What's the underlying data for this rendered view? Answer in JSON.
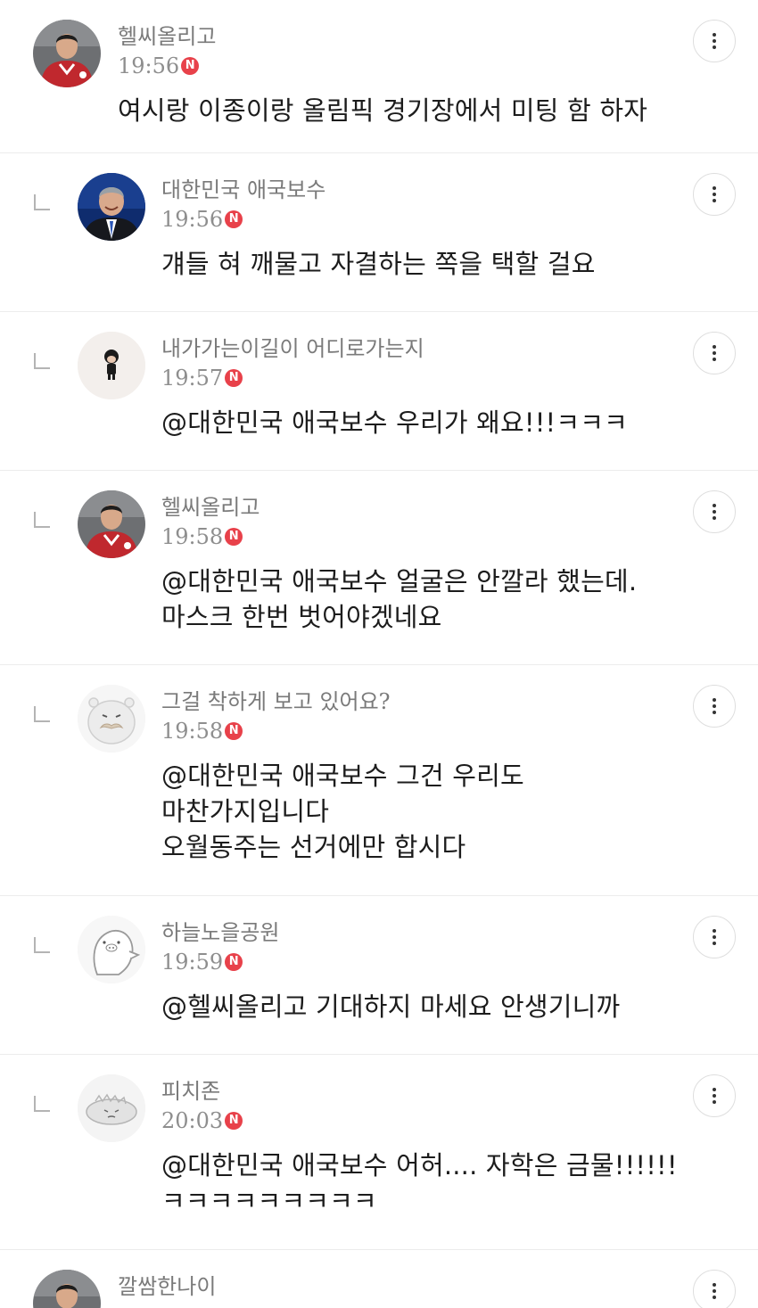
{
  "comments": [
    {
      "nickname": "헬씨올리고",
      "time": "19:56",
      "badge": "N",
      "lines": [
        "여시랑 이종이랑 올림픽 경기장에서 미팅 함 하자"
      ],
      "reply": false,
      "avatar_icon": "soccer-player-icon"
    },
    {
      "nickname": "대한민국 애국보수",
      "time": "19:56",
      "badge": "N",
      "lines": [
        "걔들 혀 깨물고 자결하는 쪽을 택할 걸요"
      ],
      "reply": true,
      "avatar_icon": "man-in-suit-icon"
    },
    {
      "nickname": "내가가는이길이 어디로가는지",
      "time": "19:57",
      "badge": "N",
      "lines": [
        "@대한민국 애국보수 우리가 왜요!!!ㅋㅋㅋ"
      ],
      "reply": true,
      "avatar_icon": "tiny-character-icon"
    },
    {
      "nickname": "헬씨올리고",
      "time": "19:58",
      "badge": "N",
      "lines": [
        "@대한민국 애국보수 얼굴은 안깔라 했는데.",
        "마스크 한번 벗어야겠네요"
      ],
      "reply": true,
      "avatar_icon": "soccer-player-icon"
    },
    {
      "nickname": "그걸 착하게 보고 있어요?",
      "time": "19:58",
      "badge": "N",
      "lines": [
        "@대한민국 애국보수 그건 우리도",
        "마찬가지입니다",
        "오월동주는 선거에만 합시다"
      ],
      "reply": true,
      "avatar_icon": "mustache-character-icon"
    },
    {
      "nickname": "하늘노을공원",
      "time": "19:59",
      "badge": "N",
      "lines": [
        "@헬씨올리고 기대하지 마세요 안생기니까"
      ],
      "reply": true,
      "avatar_icon": "pig-ghost-icon"
    },
    {
      "nickname": "피치존",
      "time": "20:03",
      "badge": "N",
      "lines": [
        "@대한민국 애국보수 어허.... 자학은 금물!!!!!!",
        "ㅋㅋㅋㅋㅋㅋㅋㅋㅋ"
      ],
      "reply": true,
      "avatar_icon": "dino-character-icon"
    },
    {
      "nickname": "깔쌈한나이",
      "time": "",
      "badge": "",
      "lines": [],
      "reply": false,
      "avatar_icon": "soccer-player-icon"
    }
  ],
  "more_button_icon": "more-vertical-icon",
  "colors": {
    "badge": "#e8414a",
    "nickname": "#7a7a7a",
    "divider": "#ececec"
  }
}
